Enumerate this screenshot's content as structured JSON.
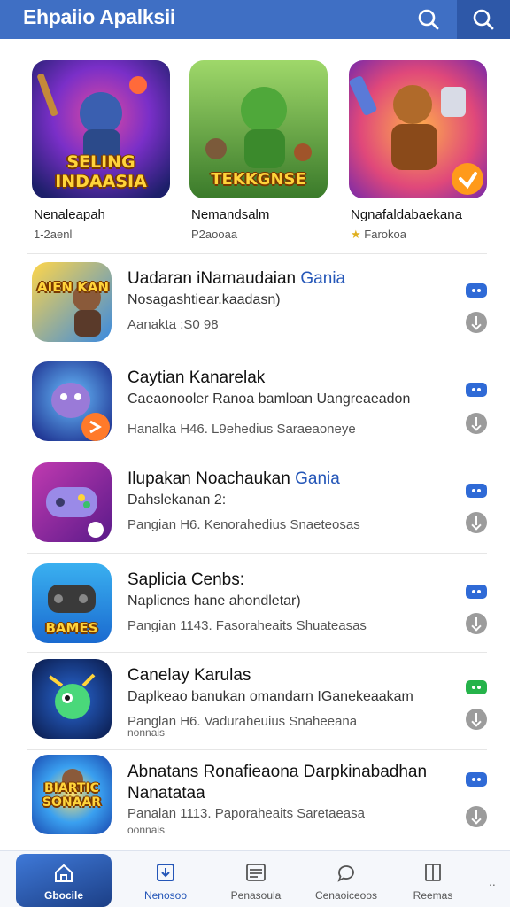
{
  "header": {
    "title": "Ehpaiio Apalksii",
    "colors": {
      "bar": "#3f6fc4",
      "search_tile": "#2e58a8"
    },
    "icons": [
      "search-icon",
      "search-icon"
    ]
  },
  "featured": [
    {
      "name": "Nenaleapah",
      "sub": "1-2aenl",
      "banner": [
        "SELING",
        "INDAASIA"
      ],
      "star": ""
    },
    {
      "name": "Nemandsalm",
      "sub": "P2aooaa",
      "banner": [
        "TEKKGNSE"
      ],
      "star": ""
    },
    {
      "name": "Ngnafaldabaekana",
      "sub": "Farokoa",
      "banner": [],
      "star": "★"
    }
  ],
  "apps": [
    {
      "title": "Uadaran iNamaudaian",
      "accent": "Gania",
      "desc": "Nosagashtiear.kaadasn)",
      "meta": "Aanakta :S0 98",
      "meta2": "",
      "icon_text": "AIEN KAN",
      "badge": "blue"
    },
    {
      "title": "Caytian Kanarelak",
      "accent": "",
      "desc": "Caeaonooler Ranoa bamloan Uangreaeadon",
      "meta": "Hanalka H46. L9ehedius Saraeaoneye",
      "meta2": "",
      "icon_text": "",
      "badge": "blue"
    },
    {
      "title": "Ilupakan Noachaukan",
      "accent": "Gania",
      "desc": "Dahslekanan 2:",
      "meta": "Pangian H6. Kenorahedius Snaeteosas",
      "meta2": "",
      "icon_text": "",
      "badge": "blue"
    },
    {
      "title": "Saplicia Cenbs:",
      "accent": "",
      "desc": "Naplicnes hane ahondletar)",
      "meta": "Pangian 1143. Fasoraheaits Shuateasas",
      "meta2": "",
      "icon_text": "BAMES",
      "badge": "blue"
    },
    {
      "title": "Canelay Karulas",
      "accent": "",
      "desc": "Daplkeao banukan omandarn IGanekeaakam",
      "meta": "Panglan H6. Vaduraheuius Snaheeana",
      "meta2": "nonnais",
      "icon_text": "",
      "badge": "green"
    },
    {
      "title": "Abnatans Ronafieaona Darpkinabadhan",
      "title2": "Nanatataa",
      "accent": "",
      "desc": "",
      "meta": "Panalan 1113. Paporaheaits Saretaeasa",
      "meta2": "oonnais",
      "icon_text": "BIARTIC SONAAR",
      "badge": "blue"
    }
  ],
  "bottom_nav": [
    {
      "label": "Gbocile",
      "icon": "home-icon",
      "active": true
    },
    {
      "label": "Nenosoo",
      "icon": "store-icon",
      "selected": true
    },
    {
      "label": "Penasoula",
      "icon": "list-icon"
    },
    {
      "label": "Cenaoiceoos",
      "icon": "chat-icon"
    },
    {
      "label": "Reemas",
      "icon": "book-icon"
    }
  ],
  "more_label": "..",
  "colors": {
    "accent": "#2456b8",
    "badge_blue": "#2f6ad6",
    "badge_green": "#25b34a"
  }
}
